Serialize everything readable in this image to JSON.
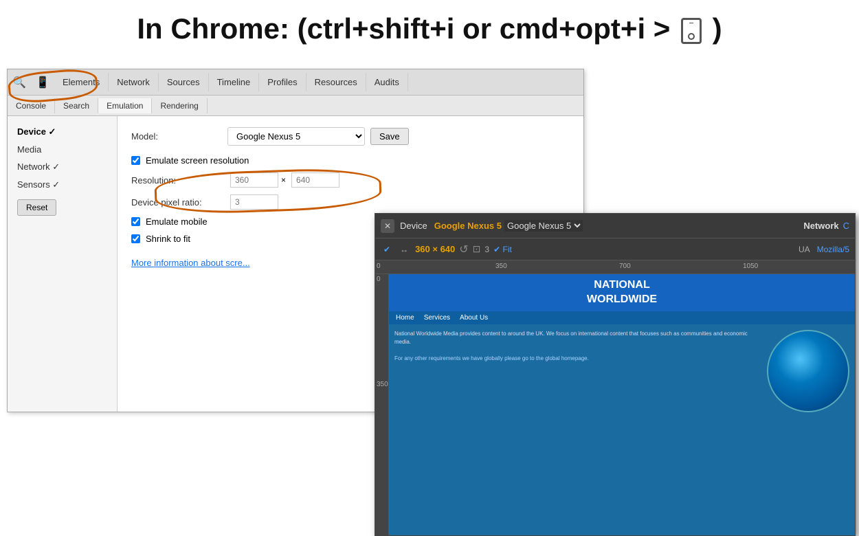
{
  "title": {
    "text": "In Chrome: (ctrl+shift+i or cmd+opt+i > ",
    "suffix": " )"
  },
  "devtools": {
    "tabs": [
      {
        "label": "Elements",
        "active": false
      },
      {
        "label": "Network",
        "active": false
      },
      {
        "label": "Sources",
        "active": false
      },
      {
        "label": "Timeline",
        "active": false
      },
      {
        "label": "Profiles",
        "active": false
      },
      {
        "label": "Resources",
        "active": false
      },
      {
        "label": "Audits",
        "active": false
      }
    ],
    "subtabs": [
      {
        "label": "Console",
        "active": false
      },
      {
        "label": "Search",
        "active": false
      },
      {
        "label": "Emulation",
        "active": true
      },
      {
        "label": "Rendering",
        "active": false
      }
    ],
    "sidebar": {
      "items": [
        {
          "label": "Device ✓",
          "active": true
        },
        {
          "label": "Media",
          "active": false
        },
        {
          "label": "Network ✓",
          "active": false
        },
        {
          "label": "Sensors ✓",
          "active": false
        }
      ],
      "reset_label": "Reset"
    },
    "content": {
      "model_label": "Model:",
      "model_value": "Google Nexus 5",
      "save_label": "Save",
      "emulate_screen_label": "Emulate screen resolution",
      "resolution_label": "Resolution:",
      "pixel_ratio_label": "Device pixel ratio:",
      "emulate_mobile_label": "Emulate mobile",
      "shrink_label": "Shrink to fit",
      "more_info_label": "More information about scre..."
    }
  },
  "overlay": {
    "header": {
      "close_label": "✕",
      "device_label": "Device",
      "device_name": "Google Nexus 5",
      "network_label": "Network",
      "c_label": "C"
    },
    "toolbar": {
      "dims": "360 × 640",
      "refresh_icon": "↺",
      "screenshot_icon": "⊡",
      "count": "3",
      "fit_label": "✔ Fit",
      "ua_label": "UA",
      "ua_value": "Mozilla/5"
    },
    "ruler": {
      "labels": [
        "0",
        "350",
        "700",
        "1050"
      ]
    },
    "preview": {
      "site_title_line1": "NATIONAL",
      "site_title_line2": "WORLDWIDE",
      "nav_items": [
        "Home",
        "Services",
        "About Us"
      ],
      "text_content": "National Worldwide Media provides content to around the UK. We focus on international content that focuses such as communities and economic media.",
      "link_text": "For any other requirements we have globally please go to the global homepage."
    }
  }
}
